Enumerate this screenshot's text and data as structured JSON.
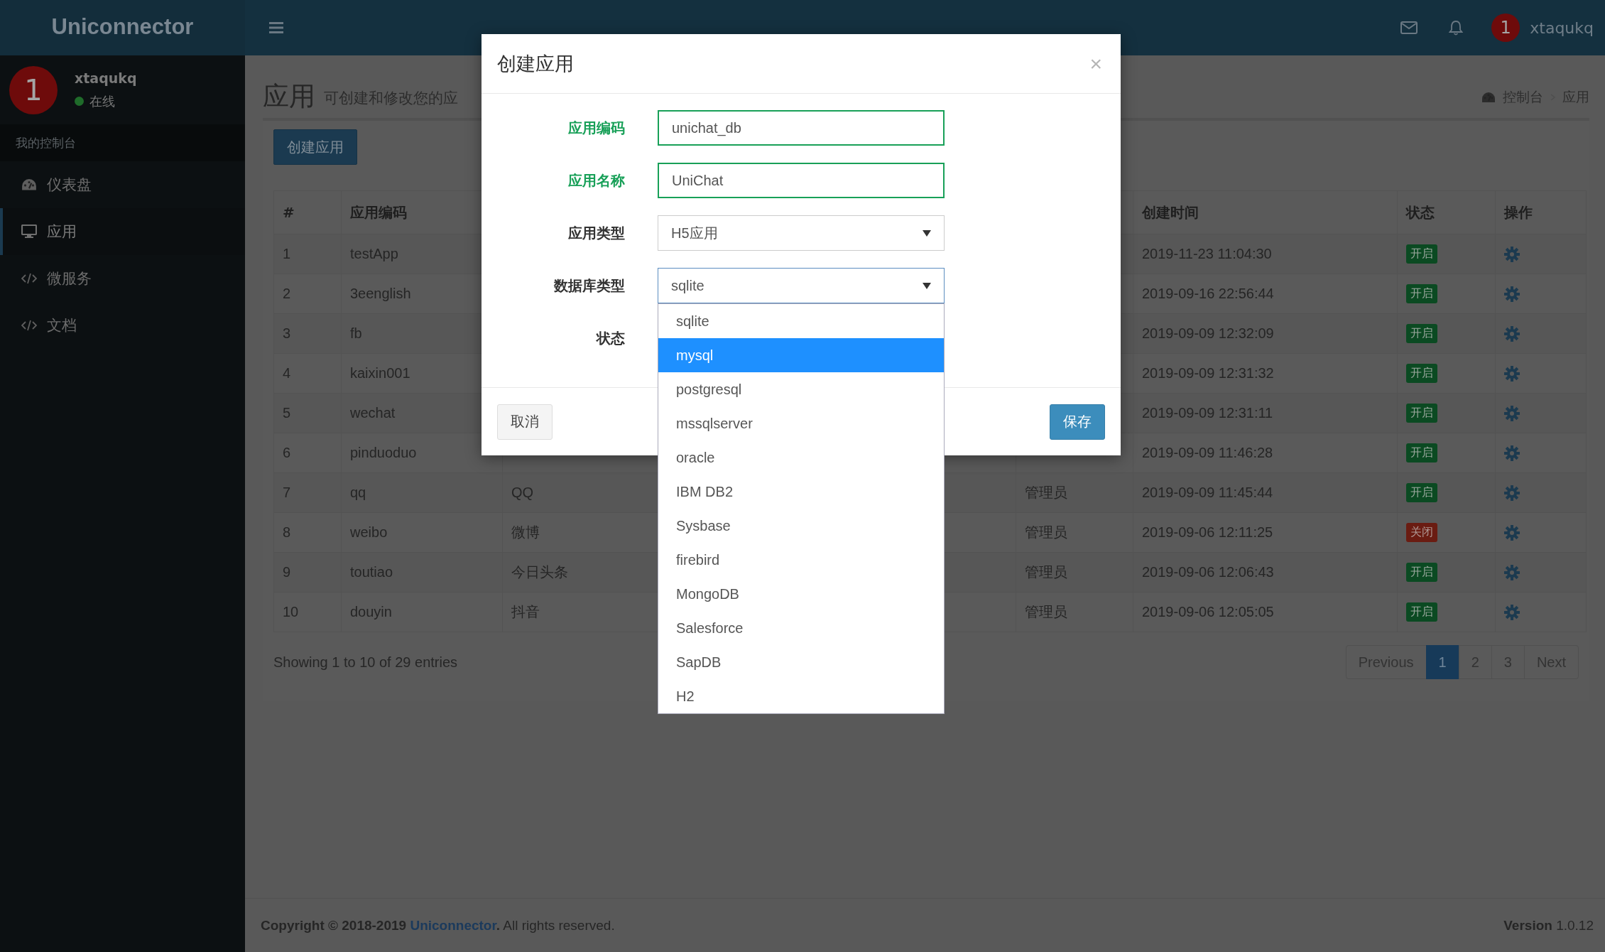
{
  "header": {
    "logo": "Uniconnector",
    "user_avatar": "1",
    "user_name": "xtaqukq"
  },
  "sidebar": {
    "user": {
      "avatar": "1",
      "name": "xtaqukq",
      "status": "在线"
    },
    "section": "我的控制台",
    "items": [
      {
        "label": "仪表盘",
        "selected": false
      },
      {
        "label": "应用",
        "selected": true
      },
      {
        "label": "微服务",
        "selected": false
      },
      {
        "label": "文档",
        "selected": false
      }
    ]
  },
  "page": {
    "title": "应用",
    "subtitle": "可创建和修改您的应",
    "breadcrumb": [
      "控制台",
      "应用"
    ],
    "create_button": "创建应用"
  },
  "table": {
    "headers": {
      "index": "#",
      "code": "应用编码",
      "created": "创建时间",
      "status": "状态",
      "actions": "操作"
    },
    "rows": [
      {
        "index": "1",
        "code": "testApp",
        "created": "2019-11-23 11:04:30",
        "status": "开启",
        "enabled": true
      },
      {
        "index": "2",
        "code": "3eenglish",
        "created": "2019-09-16 22:56:44",
        "status": "开启",
        "enabled": true
      },
      {
        "index": "3",
        "code": "fb",
        "created": "2019-09-09 12:32:09",
        "status": "开启",
        "enabled": true
      },
      {
        "index": "4",
        "code": "kaixin001",
        "created": "2019-09-09 12:31:32",
        "status": "开启",
        "enabled": true
      },
      {
        "index": "5",
        "code": "wechat",
        "created": "2019-09-09 12:31:11",
        "status": "开启",
        "enabled": true
      },
      {
        "index": "6",
        "code": "pinduoduo",
        "created": "2019-09-09 11:46:28",
        "status": "开启",
        "enabled": true
      },
      {
        "index": "7",
        "code": "qq",
        "column_3": "QQ",
        "column_4": "管理员",
        "created": "2019-09-09 11:45:44",
        "status": "开启",
        "enabled": true
      },
      {
        "index": "8",
        "code": "weibo",
        "column_3": "微博",
        "column_4": "管理员",
        "created": "2019-09-06 12:11:25",
        "status": "关闭",
        "enabled": false
      },
      {
        "index": "9",
        "code": "toutiao",
        "column_3": "今日头条",
        "column_4": "管理员",
        "created": "2019-09-06 12:06:43",
        "status": "开启",
        "enabled": true
      },
      {
        "index": "10",
        "code": "douyin",
        "column_3": "抖音",
        "column_4": "管理员",
        "created": "2019-09-06 12:05:05",
        "status": "开启",
        "enabled": true
      }
    ],
    "info": "Showing 1 to 10 of 29 entries",
    "pagination": [
      {
        "label": "Previous",
        "selected": false
      },
      {
        "label": "1",
        "selected": true
      },
      {
        "label": "2",
        "selected": false
      },
      {
        "label": "3",
        "selected": false
      },
      {
        "label": "Next",
        "selected": false
      }
    ]
  },
  "footer": {
    "copyright": "Copyright © 2018-2019",
    "link": "Uniconnector",
    "after_link": "**.** All rights reserved.",
    "version_label": "Version",
    "version": "1.0.12"
  },
  "modal": {
    "title": "创建应用",
    "close": "×",
    "fields": [
      {
        "label": "应用编码",
        "kind": "text",
        "value": "unichat_db",
        "valid": true
      },
      {
        "label": "应用名称",
        "kind": "text",
        "value": "UniChat",
        "valid": true
      },
      {
        "label": "应用类型",
        "kind": "select",
        "value": "H5应用"
      },
      {
        "label": "数据库类型",
        "kind": "select",
        "value": "sqlite",
        "open": true,
        "options": [
          {
            "label": "sqlite",
            "highlighted": false
          },
          {
            "label": "mysql",
            "highlighted": true
          },
          {
            "label": "postgresql",
            "highlighted": false
          },
          {
            "label": "mssqlserver",
            "highlighted": false
          },
          {
            "label": "oracle",
            "highlighted": false
          },
          {
            "label": "IBM DB2",
            "highlighted": false
          },
          {
            "label": "Sysbase",
            "highlighted": false
          },
          {
            "label": "firebird",
            "highlighted": false
          },
          {
            "label": "MongoDB",
            "highlighted": false
          },
          {
            "label": "Salesforce",
            "highlighted": false
          },
          {
            "label": "SapDB",
            "highlighted": false
          },
          {
            "label": "H2",
            "highlighted": false
          }
        ]
      },
      {
        "label": "状态",
        "kind": "covered"
      }
    ],
    "cancel": "取消",
    "save": "保存"
  }
}
